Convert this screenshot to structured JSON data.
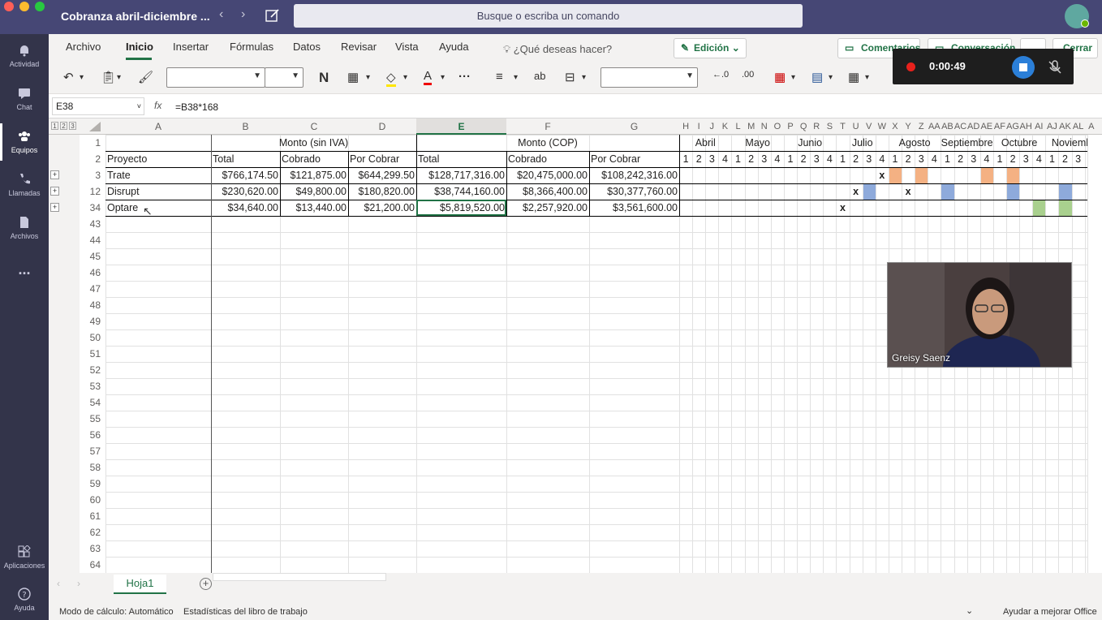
{
  "window": {
    "title": "Cobranza abril-diciembre ...",
    "command_placeholder": "Busque o escriba un comando"
  },
  "rail": [
    {
      "label": "Actividad",
      "icon": "bell-icon"
    },
    {
      "label": "Chat",
      "icon": "chat-icon"
    },
    {
      "label": "Equipos",
      "icon": "teams-icon"
    },
    {
      "label": "Llamadas",
      "icon": "phone-icon"
    },
    {
      "label": "Archivos",
      "icon": "file-icon"
    },
    {
      "label": "...",
      "icon": "more-icon"
    },
    {
      "label": "Aplicaciones",
      "icon": "apps-icon"
    },
    {
      "label": "Ayuda",
      "icon": "help-icon"
    }
  ],
  "menu": {
    "items": [
      "Archivo",
      "Inicio",
      "Insertar",
      "Fórmulas",
      "Datos",
      "Revisar",
      "Vista",
      "Ayuda"
    ],
    "tell_me": "¿Qué deseas hacer?",
    "edit_mode": "Edición",
    "comments": "Comentarios",
    "conversation": "Conversación",
    "more": "...",
    "close": "Cerrar"
  },
  "ribbon": {
    "bold": "N"
  },
  "formula_bar": {
    "name_box": "E38",
    "fx": "fx",
    "formula": "=B38*168"
  },
  "outline_levels": [
    "1",
    "2",
    "3"
  ],
  "columns": [
    "A",
    "B",
    "C",
    "D",
    "E",
    "F",
    "G"
  ],
  "narrow_columns": [
    "H",
    "I",
    "J",
    "K",
    "L",
    "M",
    "N",
    "O",
    "P",
    "Q",
    "R",
    "S",
    "T",
    "U",
    "V",
    "W",
    "X",
    "Y",
    "Z",
    "AA",
    "AB",
    "AC",
    "AD",
    "AE",
    "AF",
    "AG",
    "AH",
    "AI",
    "AJ",
    "AK",
    "AL",
    "A"
  ],
  "headers": {
    "monto_sin_iva": "Monto (sin IVA)",
    "monto_cop": "Monto (COP)",
    "proyecto": "Proyecto",
    "total": "Total",
    "cobrado": "Cobrado",
    "por_cobrar": "Por Cobrar"
  },
  "months": [
    "Abril",
    "Mayo",
    "Junio",
    "Julio",
    "Agosto",
    "Septiembre",
    "Octubre",
    "Noviemb"
  ],
  "weeks": [
    "1",
    "2",
    "3",
    "4",
    "1",
    "2",
    "3",
    "4",
    "1",
    "2",
    "3",
    "4",
    "1",
    "2",
    "3",
    "4",
    "1",
    "2",
    "3",
    "4",
    "1",
    "2",
    "3",
    "4",
    "1",
    "2",
    "3",
    "4",
    "1",
    "2",
    "3"
  ],
  "rows": [
    {
      "num": "3",
      "proyecto": "Trate",
      "b": "$766,174.50",
      "c": "$121,875.00",
      "d": "$644,299.50",
      "e": "$128,717,316.00",
      "f": "$20,475,000.00",
      "g": "$108,242,316.00"
    },
    {
      "num": "12",
      "proyecto": "Disrupt",
      "b": "$230,620.00",
      "c": "$49,800.00",
      "d": "$180,820.00",
      "e": "$38,744,160.00",
      "f": "$8,366,400.00",
      "g": "$30,377,760.00"
    },
    {
      "num": "34",
      "proyecto": "Optare",
      "b": "$34,640.00",
      "c": "$13,440.00",
      "d": "$21,200.00",
      "e": "$5,819,520.00",
      "f": "$2,257,920.00",
      "g": "$3,561,600.00"
    }
  ],
  "row_numbers_top": [
    "1",
    "2"
  ],
  "row_numbers_empty": [
    "43",
    "44",
    "45",
    "46",
    "47",
    "48",
    "49",
    "50",
    "51",
    "52",
    "53",
    "54",
    "55",
    "56",
    "57",
    "58",
    "59",
    "60",
    "61",
    "62",
    "63",
    "64"
  ],
  "marks": {
    "x": "x"
  },
  "colors": {
    "orange": "#f4b183",
    "blue": "#8eaadb",
    "green": "#a9d08e",
    "excel_green": "#217346",
    "teams_purple": "#464775"
  },
  "sheet_tab": "Hoja1",
  "status": {
    "calc": "Modo de cálculo: Automático",
    "stats": "Estadísticas del libro de trabajo",
    "feedback": "Ayudar a mejorar Office"
  },
  "recorder": {
    "time": "0:00:49"
  },
  "video": {
    "name": "Greisy Saenz"
  }
}
